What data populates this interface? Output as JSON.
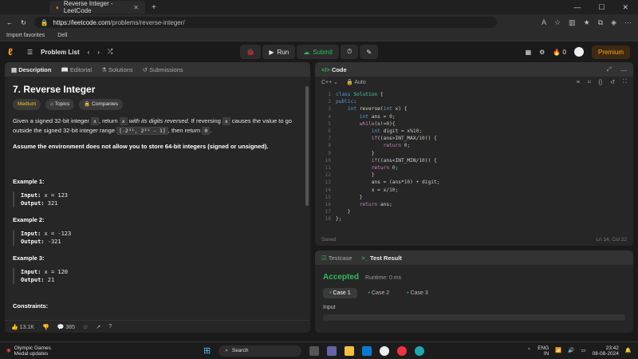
{
  "browser": {
    "tab_title": "Reverse Integer - LeetCode",
    "url_host": "https://leetcode.com",
    "url_path": "/problems/reverse-integer/",
    "bookmarks": [
      "Import favorites",
      "Dell"
    ]
  },
  "nav": {
    "problem_list": "Problem List",
    "run": "Run",
    "submit": "Submit",
    "streak": "0",
    "premium": "Premium"
  },
  "left": {
    "tabs": [
      "Description",
      "Editorial",
      "Solutions",
      "Submissions"
    ],
    "title": "7. Reverse Integer",
    "tags": [
      "Medium",
      "Topics",
      "Companies"
    ],
    "p1_a": "Given a signed 32-bit integer ",
    "p1_x": "x",
    "p1_b": ", return ",
    "p1_c": "x",
    "p1_d": " with its digits reversed",
    "p1_e": ". If reversing ",
    "p1_f": "x",
    "p1_g": " causes the value to go outside the signed 32-bit integer range ",
    "p1_range": "[-2³¹, 2³¹ - 1]",
    "p1_h": ", then return ",
    "p1_zero": "0",
    "p1_i": ".",
    "assume": "Assume the environment does not allow you to store 64-bit integers (signed or unsigned).",
    "examples": [
      {
        "title": "Example 1:",
        "input": "x = 123",
        "output": "321"
      },
      {
        "title": "Example 2:",
        "input": "x = -123",
        "output": "-321"
      },
      {
        "title": "Example 3:",
        "input": "x = 120",
        "output": "21"
      }
    ],
    "input_label": "Input:",
    "output_label": "Output:",
    "constraints": "Constraints:",
    "likes": "13.1K",
    "comments": "385"
  },
  "code": {
    "header": "Code",
    "language": "C++",
    "mode": "Auto",
    "status": "Saved",
    "cursor": "Ln 14, Col 22"
  },
  "test": {
    "tab1": "Testcase",
    "tab2": "Test Result",
    "result": "Accepted",
    "runtime": "Runtime: 0 ms",
    "cases": [
      "Case 1",
      "Case 2",
      "Case 3"
    ],
    "input_label": "Input"
  },
  "taskbar": {
    "weather_title": "Olympic Games",
    "weather_sub": "Medal updates",
    "search": "Search",
    "lang1": "ENG",
    "lang2": "IN",
    "time": "23:42",
    "date": "08-08-2024"
  }
}
